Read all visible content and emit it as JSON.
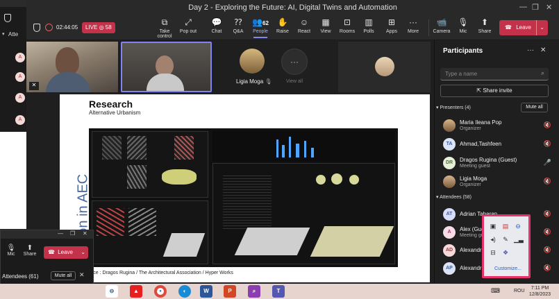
{
  "window": {
    "title": "Day 2 - Exploring the Future: AI, Digital Twins and Automation"
  },
  "meeting": {
    "timer": "02:44:05",
    "live_label": "LIVE",
    "viewers": "58"
  },
  "toolbar": {
    "take_control": "Take control",
    "pop_out": "Pop out",
    "chat": "Chat",
    "qa": "Q&A",
    "people": "People",
    "people_count": "62",
    "raise": "Raise",
    "react": "React",
    "view": "View",
    "rooms": "Rooms",
    "polls": "Polls",
    "apps": "Apps",
    "more": "More",
    "camera": "Camera",
    "mic": "Mic",
    "share": "Share",
    "leave": "Leave"
  },
  "tiles": {
    "ligia_name": "Ligia Moga",
    "view_all": "View all"
  },
  "slide": {
    "title": "Research",
    "subtitle": "Alternative Urbanism",
    "vertical_text": "mation in AEC",
    "source": "urce : Dragos Rugina  / The Architectural Association / Hyper Works"
  },
  "panel": {
    "title": "Participants",
    "search_placeholder": "Type a name",
    "share_invite": "Share invite",
    "presenters_header": "Presenters (4)",
    "mute_all": "Mute all",
    "attendees_header": "Attendees (58)",
    "presenters": [
      {
        "name": "Maria Ileana Pop",
        "role": "Organizer",
        "initials": ""
      },
      {
        "name": "Ahmad,Tashfeen",
        "role": "",
        "initials": "TA"
      },
      {
        "name": "Dragos Rugina (Guest)",
        "role": "Meeting guest",
        "initials": "DR"
      },
      {
        "name": "Ligia Moga",
        "role": "Organizer",
        "initials": ""
      }
    ],
    "attendees": [
      {
        "name": "Adrian Tabaran",
        "role": "",
        "initials": "AT"
      },
      {
        "name": "Alex (Guest)",
        "role": "Meeting guest",
        "initials": "A"
      },
      {
        "name": "Alexandra B",
        "role": "",
        "initials": "AD"
      },
      {
        "name": "Alexandru",
        "role": "",
        "initials": "AP"
      }
    ]
  },
  "lower_window": {
    "mic": "Mic",
    "share": "Share",
    "leave": "Leave",
    "attendees": "Attendees (61)",
    "mute_all": "Mute all"
  },
  "bg_window": {
    "attendees": "Atte"
  },
  "tray": {
    "customize": "Customize..."
  },
  "taskbar": {
    "lang": "ROU",
    "time": "7:11 PM",
    "date": "12/8/2023"
  },
  "colors": {
    "accent": "#7f85f5",
    "leave": "#c4314b",
    "live": "#c4314b",
    "tray_border": "#e7336b"
  }
}
